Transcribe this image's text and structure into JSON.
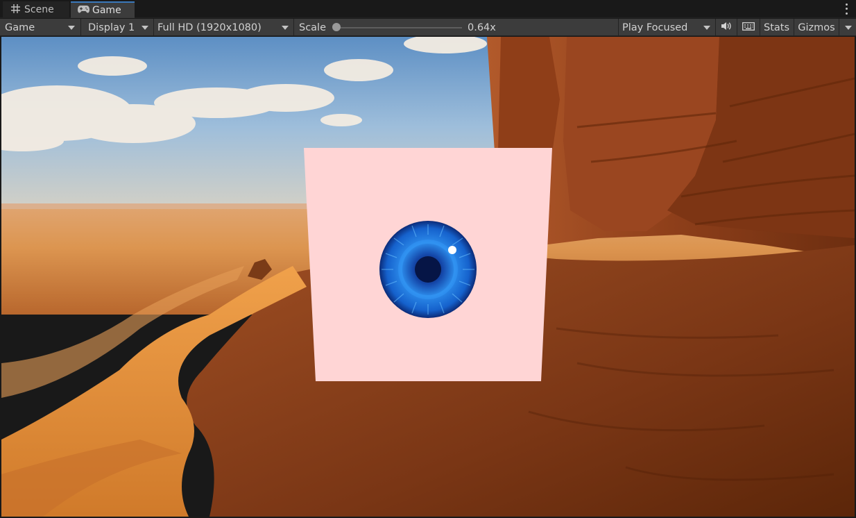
{
  "tabs": [
    {
      "label": "Scene",
      "icon": "grid-icon"
    },
    {
      "label": "Game",
      "icon": "gamepad-icon"
    }
  ],
  "toolbar": {
    "view_mode": "Game",
    "display": "Display 1",
    "resolution": "Full HD (1920x1080)",
    "scale_label": "Scale",
    "scale_value": "0.64x",
    "scale_fraction": 0.0,
    "play_mode": "Play Focused",
    "stats": "Stats",
    "gizmos": "Gizmos"
  },
  "colors": {
    "accent": "#3a79bb",
    "panel": "#3c3c3c",
    "background": "#191919",
    "card": "#ffd5d5",
    "iris": "#1b6bd6"
  }
}
